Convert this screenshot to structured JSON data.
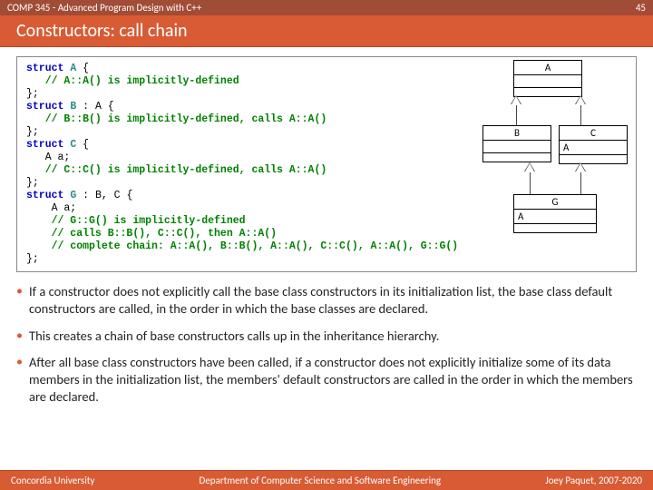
{
  "header": {
    "course": "COMP 345 - Advanced Program Design with C++",
    "page_number": "45"
  },
  "title": "Constructors: call chain",
  "code": {
    "l1a": "struct",
    "l1b": " A ",
    "l1c": "{",
    "l2": "   // A::A() is implicitly-defined",
    "l3": "};",
    "l4a": "struct",
    "l4b": " B ",
    "l4c": ": A {",
    "l5": "   // B::B() is implicitly-defined, calls A::A()",
    "l6": "};",
    "l7a": "struct",
    "l7b": " C ",
    "l7c": "{",
    "l8": "   A a;",
    "l9": "   // C::C() is implicitly-defined, calls A::A()",
    "l10": "};",
    "l11a": "struct",
    "l11b": " G ",
    "l11c": ": B, C {",
    "l12": "    A a;",
    "l13": "    // G::G() is implicitly-defined",
    "l14": "    // calls B::B(), C::C(), then A::A()",
    "l15": "    // complete chain: A::A(), B::B(), A::A(), C::C(), A::A(), G::G()",
    "l16": "};"
  },
  "uml": {
    "A": "A",
    "B": "B",
    "C": "C",
    "G": "G",
    "C_member": "A",
    "G_member": "A"
  },
  "bullets": [
    "If a constructor does not explicitly call the base class constructors in its initialization list, the base class default constructors are called, in the order in which the base classes are declared.",
    "This creates a chain of base constructors calls up in the inheritance hierarchy.",
    "After all base class constructors have been called, if a constructor does not explicitly initialize some of its data members in the initialization list, the members' default constructors are called in the order in which the members are declared."
  ],
  "footer": {
    "left": "Concordia University",
    "center": "Department of Computer Science and Software Engineering",
    "right": "Joey Paquet, 2007-2020"
  }
}
